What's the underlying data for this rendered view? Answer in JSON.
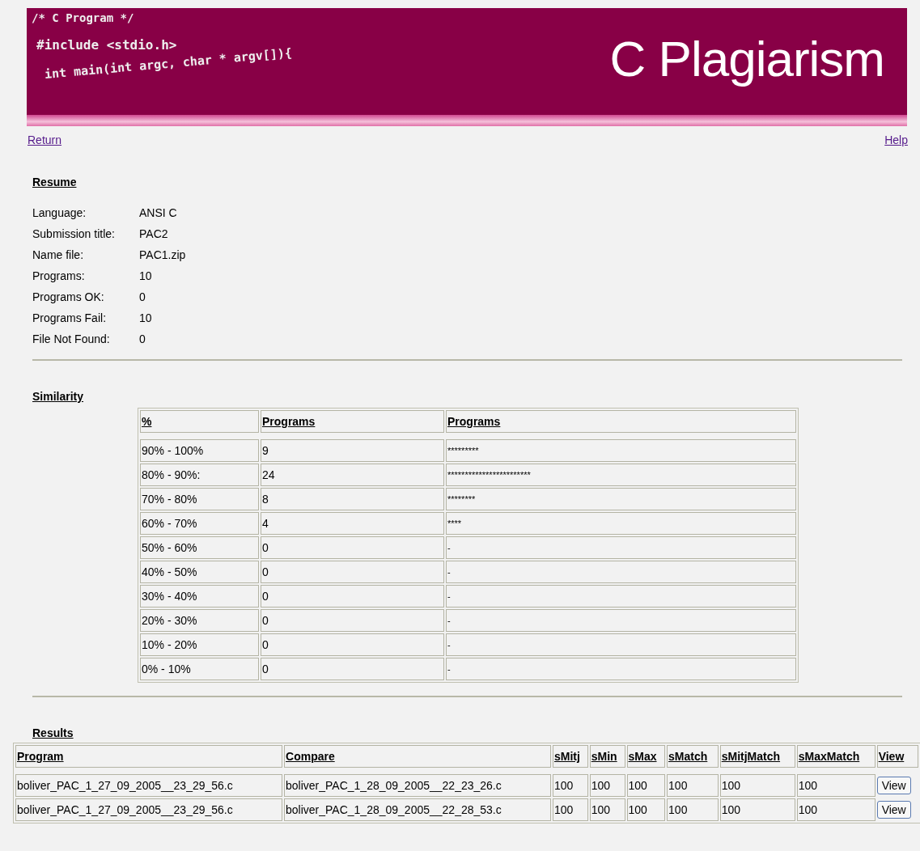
{
  "banner": {
    "code_lines": [
      "/* C Program */",
      "#include <stdio.h>",
      "int main(int argc, char * argv[]){"
    ],
    "title": "C Plagiarism"
  },
  "nav": {
    "left": "Return",
    "right": "Help"
  },
  "resume": {
    "heading": "Resume",
    "rows": [
      {
        "label": "Language:",
        "value": "ANSI C"
      },
      {
        "label": "Submission title:",
        "value": "PAC2"
      },
      {
        "label": "Name file:",
        "value": "PAC1.zip"
      },
      {
        "label": "Programs:",
        "value": "10"
      },
      {
        "label": "Programs OK:",
        "value": "0"
      },
      {
        "label": "Programs Fail:",
        "value": "10"
      },
      {
        "label": "File Not Found:",
        "value": "0"
      }
    ]
  },
  "similarity": {
    "heading": "Similarity",
    "columns": [
      "%",
      "Programs",
      "Programs"
    ],
    "rows": [
      [
        "90% - 100%",
        "9",
        "*********"
      ],
      [
        "80% - 90%:",
        "24",
        "************************"
      ],
      [
        "70% - 80%",
        "8",
        "********"
      ],
      [
        "60% - 70%",
        "4",
        "****"
      ],
      [
        "50% - 60%",
        "0",
        "-"
      ],
      [
        "40% - 50%",
        "0",
        "-"
      ],
      [
        "30% - 40%",
        "0",
        "-"
      ],
      [
        "20% - 30%",
        "0",
        "-"
      ],
      [
        "10% - 20%",
        "0",
        "-"
      ],
      [
        "0% - 10%",
        "0",
        "-"
      ]
    ]
  },
  "results": {
    "heading": "Results",
    "columns": [
      "Program",
      "Compare",
      "sMitj",
      "sMin",
      "sMax",
      "sMatch",
      "sMitjMatch",
      "sMaxMatch",
      "View"
    ],
    "rows": [
      {
        "cells": [
          "boliver_PAC_1_27_09_2005__23_29_56.c",
          "boliver_PAC_1_28_09_2005__22_23_26.c",
          "100",
          "100",
          "100",
          "100",
          "100",
          "100"
        ],
        "button": "View"
      },
      {
        "cells": [
          "boliver_PAC_1_27_09_2005__23_29_56.c",
          "boliver_PAC_1_28_09_2005__22_28_53.c",
          "100",
          "100",
          "100",
          "100",
          "100",
          "100"
        ],
        "button": "View"
      }
    ]
  }
}
